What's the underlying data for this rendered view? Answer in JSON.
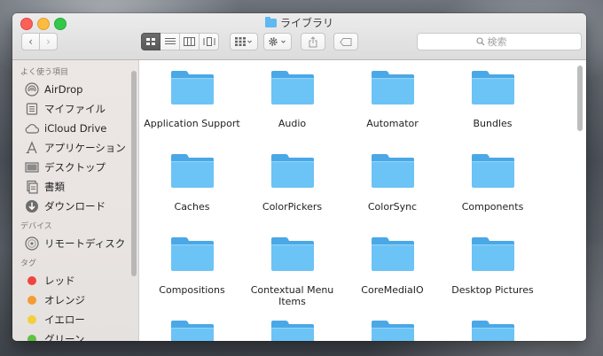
{
  "window": {
    "title": "ライブラリ"
  },
  "toolbar": {
    "back_glyph": "‹",
    "forward_glyph": "›",
    "view_modes": [
      "icon-view",
      "list-view",
      "column-view",
      "coverflow-view"
    ],
    "active_view": "icon-view",
    "arrange_icon": "grid-arrange-icon",
    "action_icon": "gear-icon",
    "share_icon": "share-icon",
    "tag_icon": "tag-icon",
    "search_placeholder": "検索"
  },
  "sidebar": {
    "favorites_heading": "よく使う項目",
    "favorites": [
      {
        "label": "AirDrop",
        "icon": "airdrop-icon"
      },
      {
        "label": "マイファイル",
        "icon": "all-my-files-icon"
      },
      {
        "label": "iCloud Drive",
        "icon": "cloud-icon"
      },
      {
        "label": "アプリケーション",
        "icon": "applications-icon"
      },
      {
        "label": "デスクトップ",
        "icon": "desktop-icon"
      },
      {
        "label": "書類",
        "icon": "documents-icon"
      },
      {
        "label": "ダウンロード",
        "icon": "downloads-icon"
      }
    ],
    "devices_heading": "デバイス",
    "devices": [
      {
        "label": "リモートディスク",
        "icon": "remote-disc-icon"
      }
    ],
    "tags_heading": "タグ",
    "tags": [
      {
        "label": "レッド",
        "color": "#f0443e"
      },
      {
        "label": "オレンジ",
        "color": "#f49b32"
      },
      {
        "label": "イエロー",
        "color": "#f3cf3c"
      },
      {
        "label": "グリーン",
        "color": "#5ec143"
      }
    ]
  },
  "colors": {
    "folder_front": "#6cc3f5",
    "folder_back": "#4aa8e6"
  },
  "folders": [
    "Application Support",
    "Audio",
    "Automator",
    "Bundles",
    "Caches",
    "ColorPickers",
    "ColorSync",
    "Components",
    "Compositions",
    "Contextual Menu Items",
    "CoreMediaIO",
    "Desktop Pictures",
    "",
    "",
    "",
    ""
  ]
}
